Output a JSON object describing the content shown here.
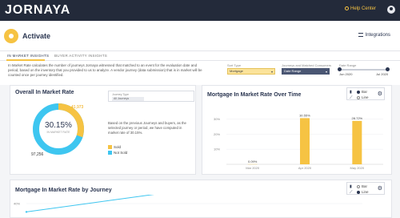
{
  "topbar": {
    "logo": "JORNAYA",
    "help_label": "Help Center"
  },
  "header": {
    "title": "Activate",
    "integrations_label": "Integrations"
  },
  "tabs": [
    {
      "label": "IN MARKET INSIGHTS",
      "active": true
    },
    {
      "label": "BUYER ACTIVITY INSIGHTS",
      "active": false
    }
  ],
  "description": "In Market Rate calculates the number of journeys Jornaya witnessed that matched to an event for the evaluation date and period, based on the inventory that you provided to us to analyze. A vendor journey (data submission) that is in market will be counted once per journey identified.",
  "filters": {
    "type": {
      "label": "Sort Type",
      "value": "Mortgage"
    },
    "journey": {
      "label": "Journeys and Matched Consumers",
      "value": "Date Range"
    },
    "date": {
      "label": "Date Range",
      "start": "Jun 2020",
      "end": "Jul 2020"
    }
  },
  "overall": {
    "title": "Overall In Market Rate",
    "tooltip_label": "Journey Type",
    "tooltip_value": "All Journeys",
    "percent_label": "30.15%",
    "donut_caption": "IN MARKET RATE",
    "sold_count": "41,973",
    "not_count": "97,256",
    "info": "Based on the previous Journeys and buyers, as the selected journey or period, we have computed in market rate of 30.15%.",
    "legend": [
      {
        "label": "Sold",
        "color": "#f6c343"
      },
      {
        "label": "Not Sold",
        "color": "#3ec6f0"
      }
    ]
  },
  "mortgage_time": {
    "title": "Mortgage In Market Rate Over Time",
    "toggle": {
      "bar_label": "Bar",
      "line_label": "Line"
    }
  },
  "by_journey": {
    "title": "Mortgage In Market Rate by Journey",
    "toggle": {
      "bar_label": "Bar",
      "line_label": "Line"
    }
  },
  "chart_data": [
    {
      "type": "pie",
      "title": "Overall In Market Rate",
      "categories": [
        "Sold",
        "Not Sold"
      ],
      "values": [
        30.15,
        69.85
      ],
      "colors": [
        "#f6c343",
        "#3ec6f0"
      ]
    },
    {
      "type": "bar",
      "title": "Mortgage In Market Rate Over Time",
      "categories": [
        "Mar 2020",
        "Apr 2020",
        "May 2020"
      ],
      "values": [
        0.09,
        30.55,
        28.72
      ],
      "data_labels": [
        "0.09%",
        "30.55%",
        "28.72%"
      ],
      "yticks": [
        "30%",
        "20%",
        "10%"
      ],
      "ylim": [
        0,
        35
      ],
      "color": "#f6c343"
    },
    {
      "type": "line",
      "title": "Mortgage In Market Rate by Journey",
      "yticks": [
        "40%"
      ],
      "series": [
        {
          "values": [
            6,
            21,
            23
          ],
          "color": "#3ec6f0"
        },
        {
          "values": [
            null,
            1,
            1
          ],
          "color": "#f6c343"
        }
      ],
      "ylim": [
        0,
        40
      ]
    }
  ]
}
